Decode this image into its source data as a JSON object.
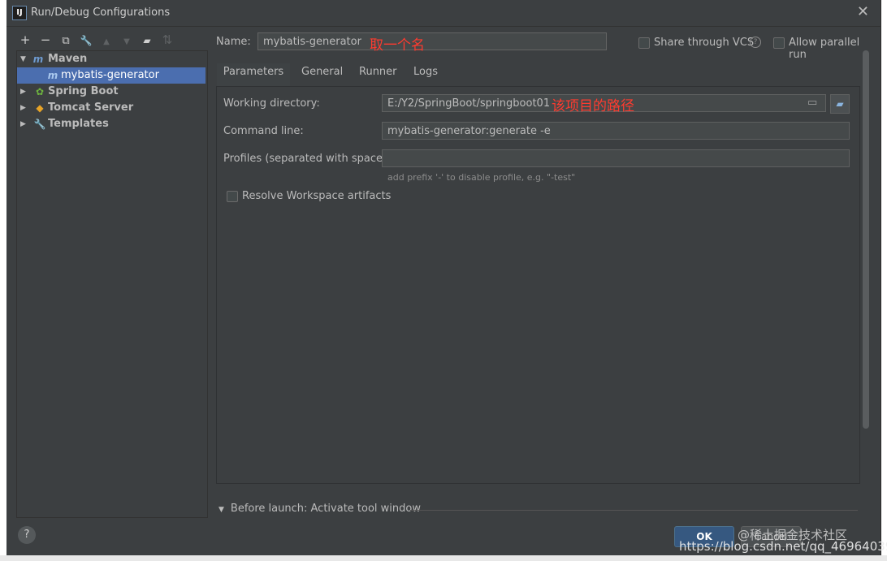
{
  "window": {
    "title": "Run/Debug Configurations",
    "close_symbol": "✕",
    "app_icon_text": "IJ"
  },
  "toolbar": {
    "add": "+",
    "remove": "−",
    "copy": "⧉",
    "edit": "🔧",
    "up": "▲",
    "down": "▼",
    "folder": "📁",
    "sort": "⇅"
  },
  "tree": {
    "maven": "Maven",
    "mybatis": "mybatis-generator",
    "spring_boot": "Spring Boot",
    "tomcat": "Tomcat Server",
    "templates": "Templates"
  },
  "name_field": {
    "label": "Name:",
    "value": "mybatis-generator"
  },
  "annotations": {
    "name_note": "取一个名",
    "path_note": "该项目的路径"
  },
  "share_vcs": "Share through VCS",
  "allow_parallel": "Allow parallel run",
  "tabs": [
    "Parameters",
    "General",
    "Runner",
    "Logs"
  ],
  "params": {
    "workdir_label": "Working directory:",
    "workdir_value": "E:/Y2/SpringBoot/springboot01",
    "cmd_label": "Command line:",
    "cmd_value": "mybatis-generator:generate -e",
    "profiles_label": "Profiles (separated with space):",
    "profiles_value": "",
    "profiles_hint": "add prefix '-' to disable profile, e.g. \"-test\"",
    "resolve_label": "Resolve Workspace artifacts"
  },
  "before_launch": "Before launch: Activate tool window",
  "buttons": {
    "ok": "OK",
    "cancel": "Cancel",
    "help": "?"
  },
  "watermark": {
    "line1": "@稀土掘金技术社区",
    "line2": "https://blog.csdn.net/qq_46964039"
  },
  "icons": [
    "maven-icon",
    "spring-boot-icon",
    "tomcat-icon",
    "wrench-icon",
    "folder-icon",
    "help-icon",
    "close-icon"
  ]
}
